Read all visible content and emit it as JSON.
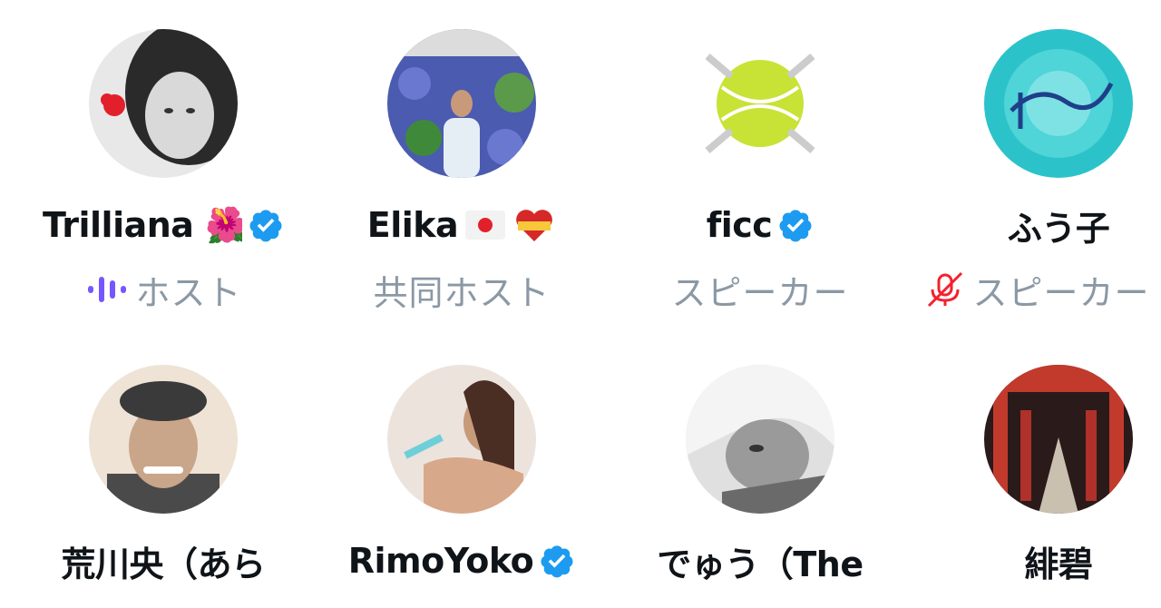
{
  "participants": [
    {
      "name": "Trilliana 🌺",
      "role": "ホスト",
      "verified": true,
      "role_icon": "speaking-wave-icon",
      "avatar_color": "#4a4a4a"
    },
    {
      "name": "Elika",
      "role": "共同ホスト",
      "verified": false,
      "emoji": [
        "japan-flag-icon",
        "spain-heart-icon"
      ],
      "avatar_color": "#4b5bb0"
    },
    {
      "name": "ficc",
      "role": "スピーカー",
      "verified": true,
      "avatar_color": "#c9e236"
    },
    {
      "name": "ふう子",
      "role": "スピーカー",
      "verified": false,
      "role_icon": "mic-muted-icon",
      "avatar_color": "#2bc3c9"
    },
    {
      "name": "荒川央（あら",
      "role": "",
      "verified": false,
      "avatar_color": "#c9a58a"
    },
    {
      "name": "RimoYoko",
      "role": "",
      "verified": true,
      "avatar_color": "#c79a7a"
    },
    {
      "name": "でゅう（The",
      "role": "",
      "verified": false,
      "avatar_color": "#9a9a9a"
    },
    {
      "name": "緋碧",
      "role": "",
      "verified": false,
      "avatar_color": "#c23a2c"
    }
  ],
  "colors": {
    "verified": "#1d9bf0",
    "muted": "#f4212e",
    "speaking": "#7856ff",
    "role_text": "#8b98a5"
  }
}
